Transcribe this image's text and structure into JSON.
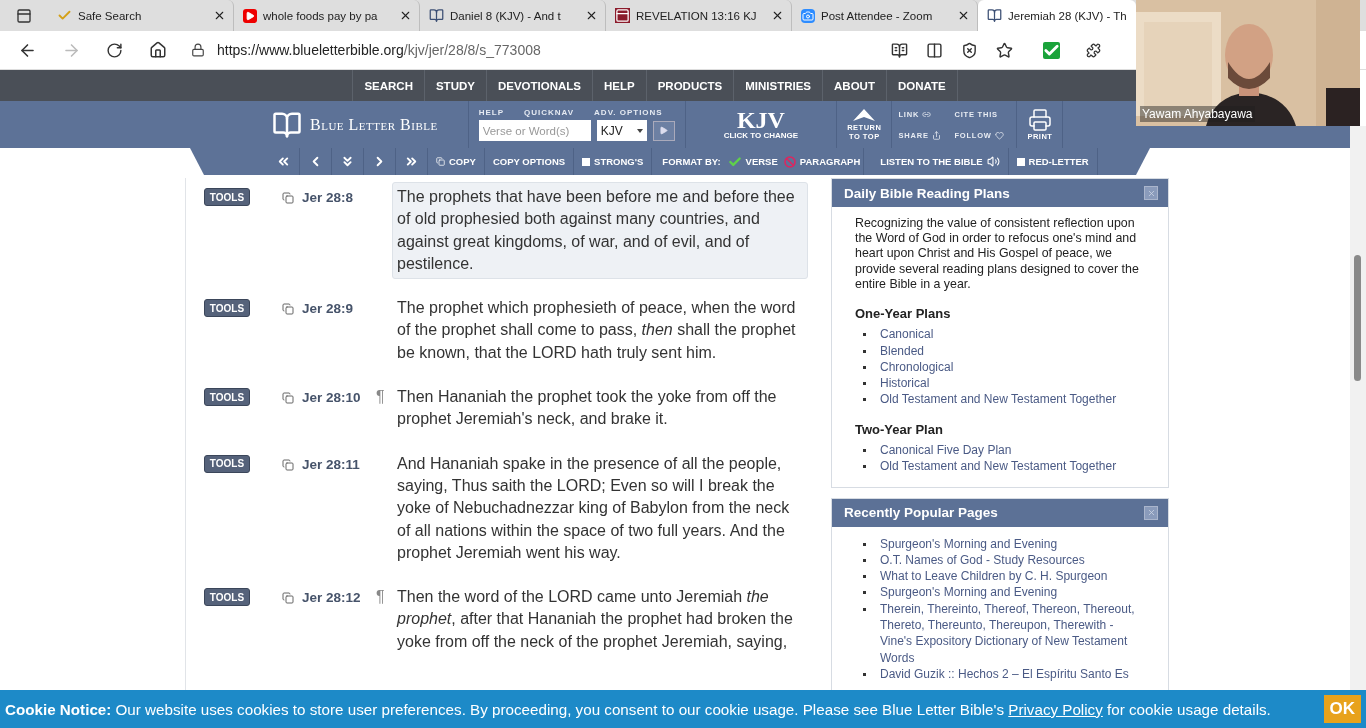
{
  "browser": {
    "tabs": [
      {
        "title": "Safe Search",
        "kind": "check",
        "selected": false
      },
      {
        "title": "whole foods pay by pa",
        "kind": "video",
        "selected": false
      },
      {
        "title": "Daniel 8 (KJV) - And t",
        "kind": "book",
        "selected": false
      },
      {
        "title": "REVELATION 13:16 KJ",
        "kind": "flag",
        "selected": false
      },
      {
        "title": "Post Attendee - Zoom",
        "kind": "camera",
        "selected": false
      },
      {
        "title": "Jeremiah 28 (KJV) - Th",
        "kind": "book",
        "selected": true
      }
    ],
    "url": {
      "host": "https://www.blueletterbible.org",
      "path": "/kjv/jer/28/8/s_773008"
    }
  },
  "site": {
    "nav": [
      "SEARCH",
      "STUDY",
      "DEVOTIONALS",
      "HELP",
      "PRODUCTS",
      "MINISTRIES",
      "ABOUT",
      "DONATE"
    ],
    "logo": "Blue Letter Bible",
    "search_labels": [
      "HELP",
      "QUICKNAV",
      "ADV. OPTIONS"
    ],
    "search": {
      "placeholder": "Verse or Word(s)"
    },
    "version_select": "KJV",
    "version": {
      "name": "KJV",
      "hint": "CLICK TO CHANGE"
    },
    "return_top": [
      "RETURN",
      "TO TOP"
    ],
    "links": [
      {
        "kind": "link",
        "label": "LINK"
      },
      {
        "kind": "cite",
        "label": "CITE THIS"
      },
      {
        "kind": "share",
        "label": "SHARE"
      },
      {
        "kind": "follow",
        "label": "FOLLOW"
      }
    ],
    "print": "PRINT",
    "toolbar": [
      {
        "kind": "first"
      },
      {
        "kind": "prev"
      },
      {
        "kind": "down"
      },
      {
        "kind": "next"
      },
      {
        "kind": "last"
      },
      {
        "kind": "copy",
        "label": "COPY"
      },
      {
        "kind": "plain",
        "label": "COPY OPTIONS"
      },
      {
        "kind": "checkbox",
        "label": "STRONG'S",
        "checked": false
      },
      {
        "kind": "heading",
        "label": "FORMAT BY:"
      },
      {
        "kind": "radio",
        "label": "VERSE",
        "selected": true
      },
      {
        "kind": "radio",
        "label": "PARAGRAPH",
        "selected": false
      },
      {
        "kind": "audio",
        "label": "LISTEN TO THE BIBLE"
      },
      {
        "kind": "checkbox",
        "label": "RED-LETTER",
        "checked": false
      }
    ]
  },
  "verses": [
    {
      "tools": "TOOLS",
      "ref": "Jer 28:8",
      "selected": true,
      "text": "The prophets that have been before me and before thee of old prophesied both against many countries, and against great kingdoms, of war, and of evil, and of pestilence."
    },
    {
      "tools": "TOOLS",
      "ref": "Jer 28:9",
      "selected": false,
      "text": "The prophet which prophesieth of peace, when the word of the prophet shall come to pass, *then* shall the prophet be known, that the LORD hath truly sent him."
    },
    {
      "tools": "TOOLS",
      "ref": "Jer 28:10",
      "pilcrow": "¶",
      "selected": false,
      "text": "Then Hananiah the prophet took the yoke from off the prophet Jeremiah's neck, and brake it."
    },
    {
      "tools": "TOOLS",
      "ref": "Jer 28:11",
      "selected": false,
      "text": "And Hananiah spake in the presence of all the people, saying, Thus saith the LORD; Even so will I break the yoke of Nebuchadnezzar king of Babylon from the neck of all nations within the space of two full years. And the prophet Jeremiah went his way."
    },
    {
      "tools": "TOOLS",
      "ref": "Jer 28:12",
      "pilcrow": "¶",
      "selected": false,
      "text": "Then the word of the LORD came unto Jeremiah *the prophet*, after that Hananiah the prophet had broken the yoke from off the neck of the prophet Jeremiah, saying,"
    }
  ],
  "sidebar": [
    {
      "title": "Daily Bible Reading Plans",
      "intro": "Recognizing the value of consistent reflection upon the Word of God in order to refocus one's mind and heart upon Christ and His Gospel of peace, we provide several reading plans designed to cover the entire Bible in a year.",
      "sections": [
        {
          "heading": "One-Year Plans",
          "links": [
            "Canonical",
            "Blended",
            "Chronological",
            "Historical",
            "Old Testament and New Testament Together"
          ]
        },
        {
          "heading": "Two-Year Plan",
          "links": [
            "Canonical Five Day Plan",
            "Old Testament and New Testament Together"
          ]
        }
      ]
    },
    {
      "title": "Recently Popular Pages",
      "sections": [
        {
          "links": [
            "Spurgeon's Morning and Evening",
            "O.T. Names of God - Study Resources",
            "What to Leave Children by C. H. Spurgeon",
            "Spurgeon's Morning and Evening",
            "Therein, Thereinto, Thereof, Thereon, Thereout, Thereto, Thereunto, Thereupon, Therewith - Vine's Expository Dictionary of New Testament Words",
            "David Guzik :: Hechos 2 – El Espíritu Santo Es"
          ]
        }
      ]
    }
  ],
  "cookie": {
    "text": "**Cookie Notice:** Our website uses cookies to store user preferences. By proceeding, you consent to our cookie usage. Please see Blue Letter Bible's",
    "link": "Privacy Policy",
    "tail": "for cookie usage details.",
    "button": "OK"
  },
  "video": {
    "name": "Yawam Ahyabayawa"
  }
}
